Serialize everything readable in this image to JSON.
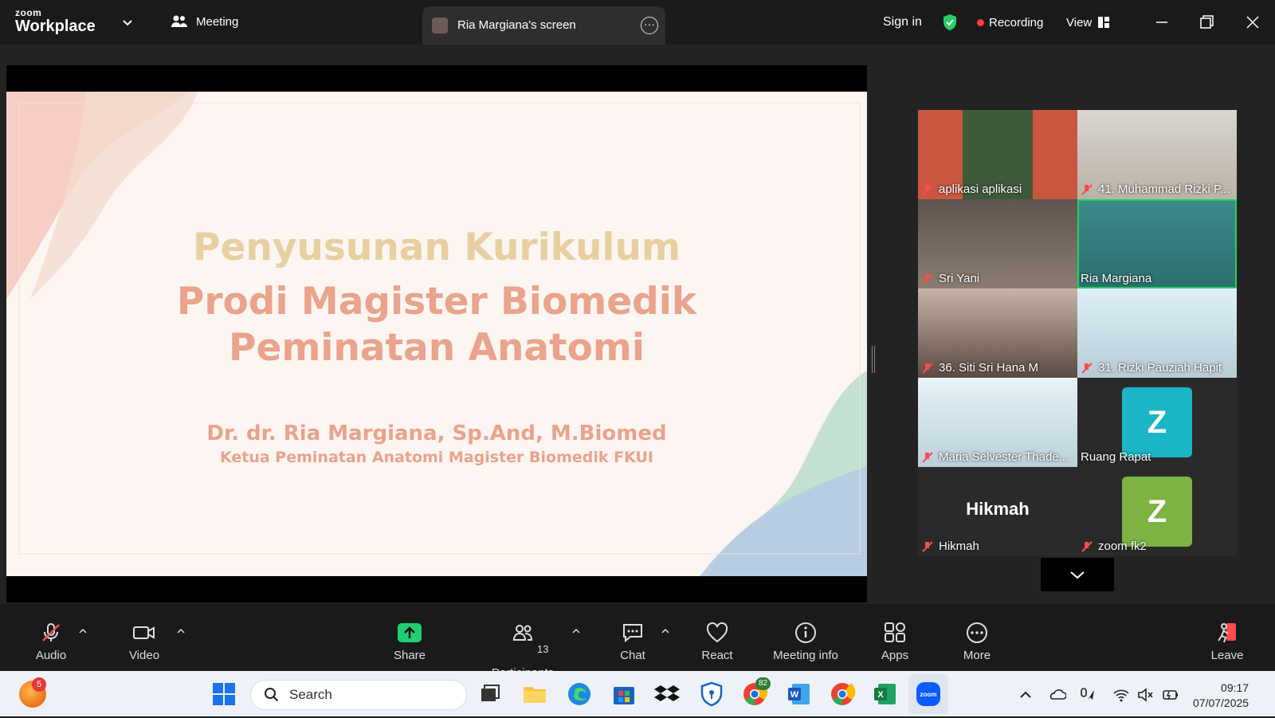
{
  "app": {
    "brand_top": "zoom",
    "brand_bottom": "Workplace",
    "meeting_tab": "Meeting"
  },
  "screen_tab": {
    "label": "Ria Margiana's screen"
  },
  "header": {
    "sign_in": "Sign in",
    "recording": "Recording",
    "view": "View"
  },
  "slide": {
    "title_line1": "Penyusunan Kurikulum",
    "title_line2": "Prodi Magister Biomedik",
    "title_line3": "Peminatan Anatomi",
    "author": "Dr. dr. Ria Margiana, Sp.And, M.Biomed",
    "role": "Ketua Peminatan Anatomi Magister Biomedik FKUI"
  },
  "participants": [
    {
      "name": "aplikasi aplikasi",
      "muted": true
    },
    {
      "name": "41. Muhammad Rizki P...",
      "muted": true
    },
    {
      "name": "Sri Yani",
      "muted": true
    },
    {
      "name": "Ria Margiana",
      "muted": false,
      "active": true
    },
    {
      "name": "36. Siti Sri Hana M",
      "muted": true
    },
    {
      "name": "31. Rizki Pauziah Hapit",
      "muted": true
    },
    {
      "name": "Maria Selvester Thade...",
      "muted": true
    },
    {
      "name": "Ruang Rapat",
      "muted": false,
      "avatar": "Z",
      "avatar_color": "#1bb5c7"
    },
    {
      "name": "Hikmah",
      "muted": true,
      "avatar_text": "Hikmah"
    },
    {
      "name": "zoom fk2",
      "muted": true,
      "avatar": "Z",
      "avatar_color": "#7cb342"
    }
  ],
  "toolbar": {
    "audio": "Audio",
    "video": "Video",
    "share": "Share",
    "participants": "Participants",
    "participants_count": "13",
    "chat": "Chat",
    "react": "React",
    "meeting_info": "Meeting info",
    "apps": "Apps",
    "more": "More",
    "leave": "Leave"
  },
  "taskbar": {
    "search_placeholder": "Search",
    "time": "09:17",
    "date": "07/07/2025",
    "notification_badge": "5",
    "chrome_badge": "82"
  },
  "colors": {
    "accent_green": "#23d160",
    "share_green": "#1fd070",
    "record_red": "#ff3b3b",
    "zoom_blue": "#0b5cff"
  }
}
